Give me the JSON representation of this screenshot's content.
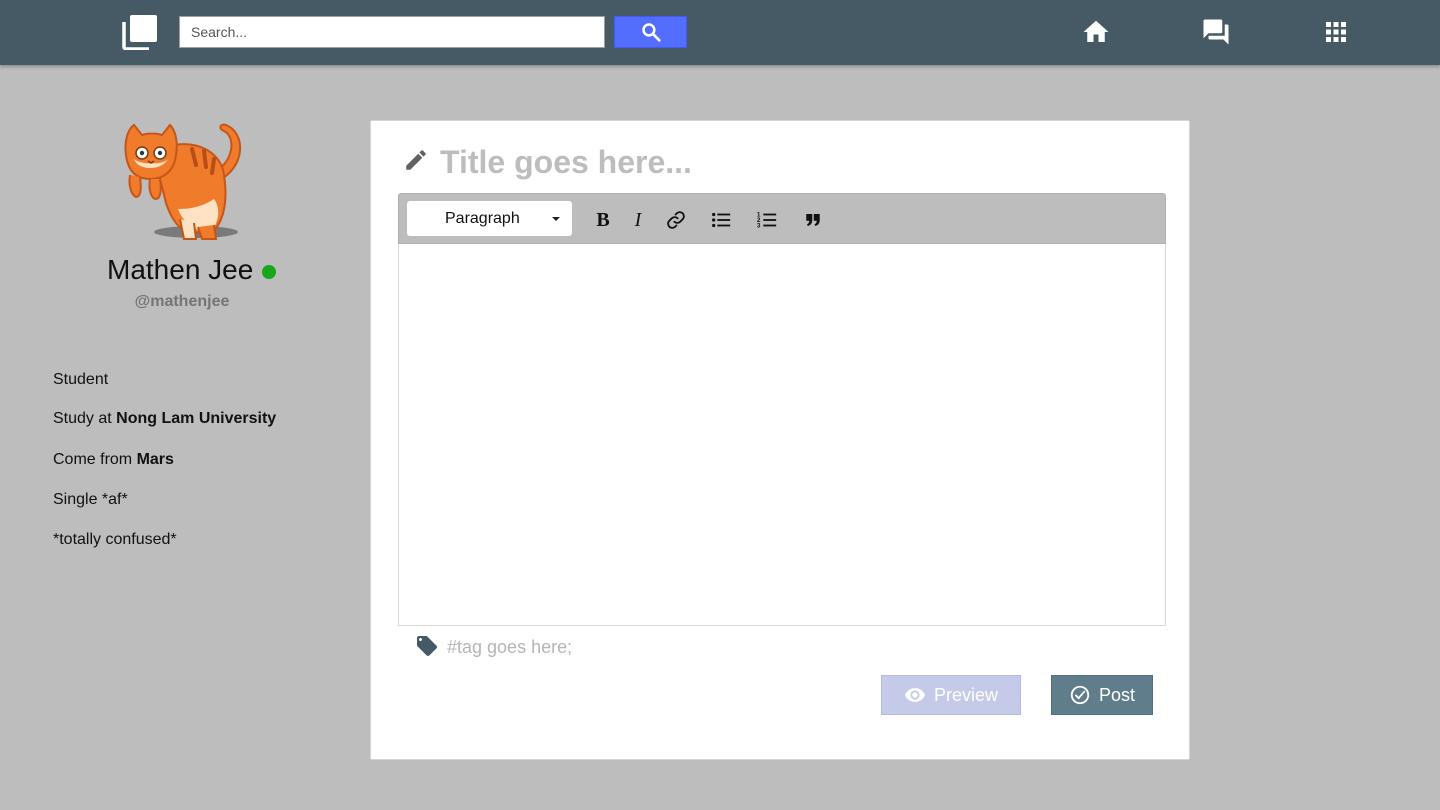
{
  "header": {
    "logo_icon": "layers-icon",
    "search": {
      "placeholder": "Search...",
      "value": "",
      "button_icon": "search-icon",
      "button_color": "#536dfe"
    },
    "nav_icons": [
      "home-icon",
      "forum-icon",
      "apps-grid-icon"
    ],
    "background": "#455a64"
  },
  "profile": {
    "avatar": "orange-cat-avatar",
    "name": "Mathen Jee",
    "online": true,
    "online_color": "#1aa51a",
    "handle": "@mathenjee",
    "bio": [
      {
        "text": "Student",
        "bold": ""
      },
      {
        "text": "Study at ",
        "bold": "Nong Lam University"
      },
      {
        "text": "Come from ",
        "bold": "Mars"
      },
      {
        "text": "Single *af*",
        "bold": ""
      },
      {
        "text": "*totally confused*",
        "bold": ""
      }
    ]
  },
  "editor": {
    "title_icon": "pencil-icon",
    "title_placeholder": "Title goes here...",
    "title_value": "",
    "toolbar": {
      "format_selected": "Paragraph",
      "bold_label": "B",
      "italic_label": "I",
      "buttons": [
        "bold-icon",
        "italic-icon",
        "link-icon",
        "bulleted-list-icon",
        "numbered-list-icon",
        "blockquote-icon"
      ]
    },
    "body_value": "",
    "tag_icon": "tag-icon",
    "tag_placeholder": "#tag goes here;",
    "tag_value": "",
    "preview_button": {
      "label": "Preview",
      "icon": "eye-icon",
      "color": "#c5cae9"
    },
    "post_button": {
      "label": "Post",
      "icon": "check-circle-icon",
      "color": "#607d8b"
    }
  }
}
